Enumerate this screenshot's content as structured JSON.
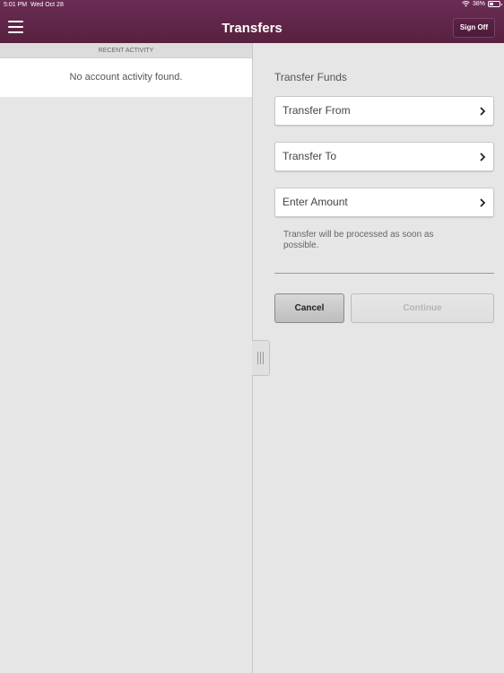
{
  "status_bar": {
    "time": "5:01 PM",
    "date": "Wed Oct 28",
    "battery": "38%",
    "battery_level": 0.38,
    "icons": [
      "wifi-icon",
      "battery-icon"
    ]
  },
  "header": {
    "title": "Transfers",
    "menu_icon": "hamburger-menu-icon",
    "sign_off_label": "Sign Off",
    "colors": {
      "background": "#5e2449",
      "text": "#ffffff"
    }
  },
  "left_pane": {
    "section_header": "RECENT ACTIVITY",
    "empty_message": "No account activity found."
  },
  "transfer_form": {
    "title": "Transfer Funds",
    "fields": [
      {
        "label": "Transfer From",
        "icon": "chevron-right-icon"
      },
      {
        "label": "Transfer To",
        "icon": "chevron-right-icon"
      },
      {
        "label": "Enter Amount",
        "icon": "chevron-right-icon"
      }
    ],
    "note": "Transfer will be processed as soon as possible.",
    "cancel_label": "Cancel",
    "continue_label": "Continue",
    "continue_enabled": false
  }
}
